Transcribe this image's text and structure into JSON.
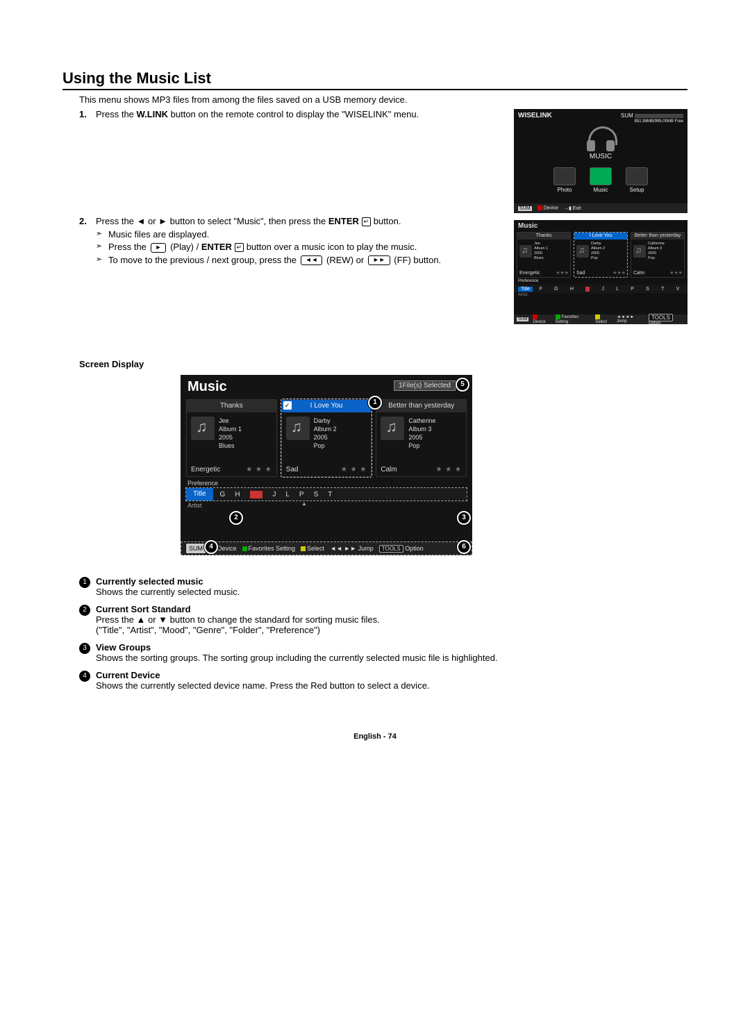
{
  "title": "Using the Music List",
  "intro": "This menu shows MP3 files from among the files saved on a USB memory device.",
  "steps": {
    "s1_num": "1.",
    "s1_a": "Press the ",
    "s1_b_bold": "W.LINK",
    "s1_c": " button on the remote control to display the \"WISELINK\" menu.",
    "s2_num": "2.",
    "s2_a": "Press the ◄ or ► button to select \"Music\", then press the ",
    "s2_b_bold": "ENTER",
    "s2_c": " button.",
    "b1": "Music files are displayed.",
    "b2a": "Press the ",
    "b2b": " (Play) / ",
    "b2b_bold": "ENTER",
    "b2c": " button over a music icon to play the music.",
    "b3a": "To move to the previous / next group, press the ",
    "b3b": " (REW) or ",
    "b3c": " (FF) button."
  },
  "glyphs": {
    "play": "►",
    "rew": "◄◄",
    "ff": "►►",
    "enter": "↵"
  },
  "wiselink": {
    "title": "WISELINK",
    "mem": "851.98MB/995.00MB Free",
    "sum": "SUM",
    "center_label": "MUSIC",
    "photo": "Photo",
    "music": "Music",
    "setup": "Setup",
    "device": "Device",
    "exit_glyph": "→▮",
    "exit": "Exit"
  },
  "musiclist": {
    "title": "Music",
    "selected_badge": "1File(s) Selected",
    "cols": [
      {
        "h": "Thanks",
        "artist": "Jee",
        "album": "Album 1",
        "year": "2005",
        "genre": "Blues",
        "mood": "Energetic"
      },
      {
        "h": "I Love You",
        "artist": "Darby",
        "album": "Album 2",
        "year": "2005",
        "genre": "Pop",
        "mood": "Sad"
      },
      {
        "h": "Better than yesterday",
        "artist": "Catherine",
        "album": "Album 3",
        "year": "2005",
        "genre": "Pop",
        "mood": "Calm"
      }
    ],
    "stars": "★ ★ ★",
    "preference": "Preference",
    "sort_current": "Title",
    "artist_label": "Artist",
    "letters": [
      "F",
      "G",
      "H",
      "J",
      "L",
      "P",
      "S",
      "T",
      "V"
    ],
    "sum": "SUM",
    "bar": {
      "device": "Device",
      "fav": "Favorites Setting",
      "select": "Select",
      "jump": "Jump",
      "option": "Option",
      "jump_glyph": "◄◄ ►►",
      "opt_glyph": "TOOLS"
    }
  },
  "screen_display_heading": "Screen Display",
  "callouts": {
    "c1": "1",
    "c2": "2",
    "c3": "3",
    "c4": "4",
    "c5": "5",
    "c6": "6"
  },
  "legend": [
    {
      "num": "1",
      "title": "Currently selected music",
      "body": "Shows the currently selected music."
    },
    {
      "num": "2",
      "title": "Current Sort Standard",
      "body": "Press the ▲ or ▼ button to change the standard for sorting music files.\n(\"Title\", \"Artist\", \"Mood\", \"Genre\", \"Folder\", \"Preference\")"
    },
    {
      "num": "3",
      "title": "View Groups",
      "body": "Shows the sorting groups. The sorting group including the currently selected music file is highlighted."
    },
    {
      "num": "4",
      "title": "Current Device",
      "body": "Shows the currently selected device name. Press the Red button to select a device."
    }
  ],
  "footer": "English - 74"
}
